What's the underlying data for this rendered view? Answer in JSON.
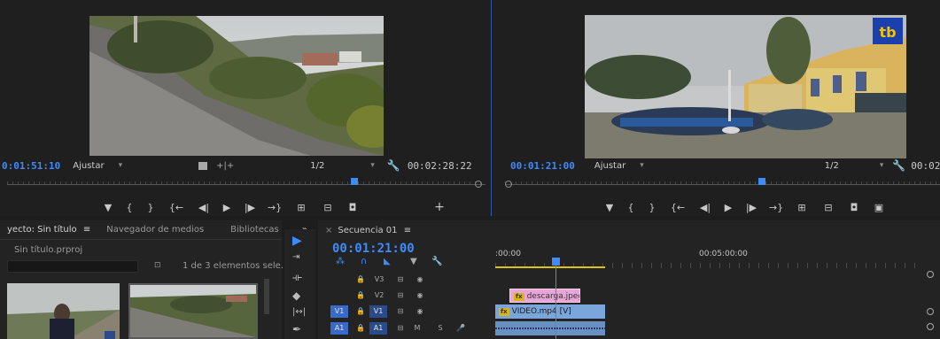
{
  "source_monitor": {
    "timecode": "0:01:51:10",
    "zoom_select": "Ajustar",
    "resolution_select": "1/2",
    "duration": "00:02:28:22",
    "playhead_fraction": 0.74
  },
  "program_monitor": {
    "timecode": "00:01:21:00",
    "zoom_select": "Ajustar",
    "resolution_select": "1/2",
    "duration": "00:02",
    "watermark": "tb",
    "playhead_fraction": 0.58
  },
  "project_panel": {
    "tabs": [
      "yecto: Sin título",
      "Navegador de medios",
      "Bibliotecas"
    ],
    "tab_menu_glyph": "≡",
    "overflow_glyph": "»",
    "file_name": "Sin título.prproj",
    "item_count": "1 de 3 elementos sele..."
  },
  "timeline": {
    "tab_label": "Secuencia 01",
    "tab_close_glyph": "×",
    "tab_menu_glyph": "≡",
    "timecode": "00:01:21:00",
    "time_start": ":00:00",
    "time_mark": "00:05:00:00",
    "tracks": [
      {
        "id": "V3",
        "source": "",
        "clip": ""
      },
      {
        "id": "V2",
        "source": "",
        "clip": "descarga.jpeg"
      },
      {
        "id": "V1",
        "source": "V1",
        "clip": "VIDEO.mp4 [V]"
      },
      {
        "id": "A1",
        "source": "A1",
        "clip": "",
        "m": "M",
        "s": "S"
      }
    ]
  },
  "colors": {
    "accent_blue": "#3d8bfd",
    "video_clip": "#7ba6db",
    "still_clip": "#e8a6d8",
    "work_area": "#d8c21b",
    "fx_badge": "#d9b515"
  }
}
